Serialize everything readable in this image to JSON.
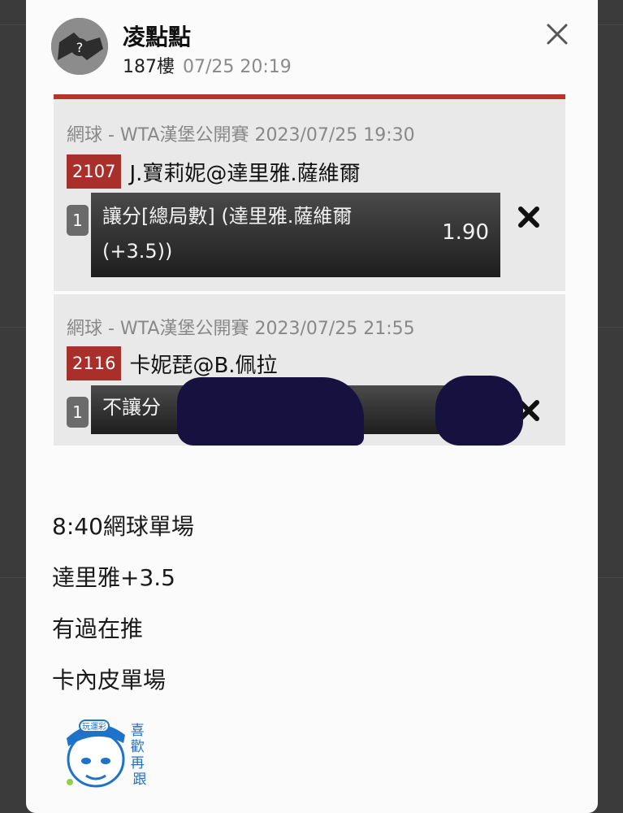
{
  "post": {
    "author": "凌點點",
    "floor": "187樓",
    "timestamp": "07/25 20:19",
    "lines": [
      "8:40網球單場",
      "達里雅+3.5",
      "有過在推",
      "卡內皮單場"
    ]
  },
  "bets": [
    {
      "header": "網球 - WTA漢堡公開賽 2023/07/25 19:30",
      "match_no": "2107",
      "teams": "J.寶莉妮@達里雅.薩維爾",
      "index": "1",
      "pick": "讓分[總局數] (達里雅.薩維爾 (+3.5))",
      "odds": "1.90"
    },
    {
      "header": "網球 - WTA漢堡公開賽 2023/07/25 21:55",
      "match_no": "2116",
      "teams": "卡妮琵@B.佩拉",
      "index": "1",
      "pick": "不讓分",
      "odds": ""
    }
  ],
  "sticker": {
    "top_text": "玩運彩",
    "side_text": "喜歡再跟"
  },
  "icons": {
    "close": "close-icon",
    "remove": "remove-x-icon",
    "avatar": "avatar-placeholder"
  },
  "colors": {
    "accent_red": "#b7342a",
    "match_no_bg": "#a9302a",
    "redaction": "#17113f",
    "sticker_blue": "#1e72c8"
  }
}
